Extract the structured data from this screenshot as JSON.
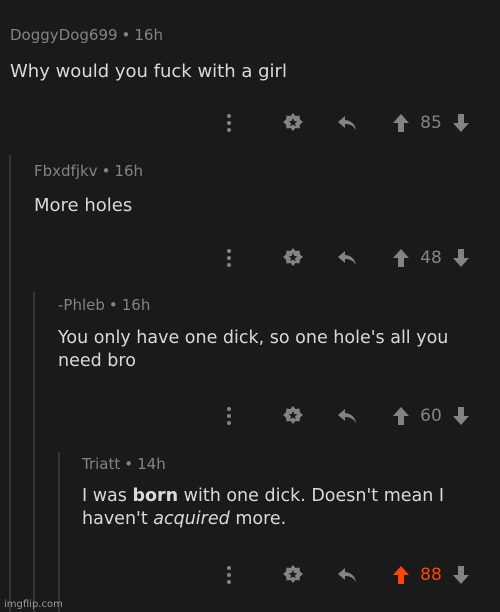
{
  "comments": [
    {
      "author": "DoggyDog699",
      "age": "16h",
      "text": "Why would you fuck with a girl",
      "score": "85"
    },
    {
      "author": "Fbxdfjkv",
      "age": "16h",
      "text": "More holes",
      "score": "48"
    },
    {
      "author": "-Phleb",
      "age": "16h",
      "text_l1": "You only have one dick, so one hole's all you",
      "text_l2": "need bro",
      "score": "60"
    },
    {
      "author": "Triatt",
      "age": "14h",
      "t1": "I was ",
      "t2": "born",
      "t3": " with one dick. Doesn't mean I",
      "t4": "haven't ",
      "t5": "acquired",
      "t6": " more.",
      "score": "88",
      "upvoted": true
    }
  ],
  "separator": "•",
  "watermark": "imgflip.com",
  "colors": {
    "background": "#1a1a1b",
    "text": "#d7dadc",
    "meta": "#818384",
    "upvote_active": "#ff4500"
  },
  "icons": [
    "more-options-icon",
    "award-icon",
    "reply-icon",
    "upvote-icon",
    "downvote-icon"
  ]
}
